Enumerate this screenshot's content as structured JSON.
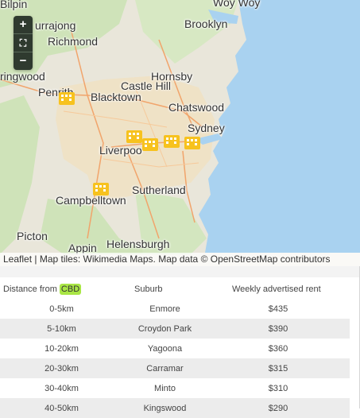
{
  "map": {
    "places": [
      {
        "key": "bilpin",
        "name": "Bilpin"
      },
      {
        "key": "kurrajong",
        "name": "urrajong"
      },
      {
        "key": "richmond",
        "name": "Richmond"
      },
      {
        "key": "springwood",
        "name": "ringwood"
      },
      {
        "key": "penrith",
        "name": "Penrith"
      },
      {
        "key": "blacktown",
        "name": "Blacktown"
      },
      {
        "key": "castlehill",
        "name": "Castle Hill"
      },
      {
        "key": "hornsby",
        "name": "Hornsby"
      },
      {
        "key": "brooklyn",
        "name": "Brooklyn"
      },
      {
        "key": "woywoy",
        "name": "Woy Woy"
      },
      {
        "key": "chatswood",
        "name": "Chatswood"
      },
      {
        "key": "sydney",
        "name": "Sydney"
      },
      {
        "key": "liverpool",
        "name": "Liverpoo"
      },
      {
        "key": "sutherland",
        "name": "Sutherland"
      },
      {
        "key": "campbelltown",
        "name": "Campbelltown"
      },
      {
        "key": "picton",
        "name": "Picton"
      },
      {
        "key": "appin",
        "name": "Appin"
      },
      {
        "key": "helensburgh",
        "name": "Helensburgh"
      }
    ],
    "zoom": {
      "in_label": "+",
      "fullscreen_label": "⛶",
      "out_label": "−"
    },
    "marker_icon": "building-marker-icon",
    "attribution": {
      "leaflet": "Leaflet",
      "separator": " | ",
      "text": "Map tiles: Wikimedia Maps. Map data © OpenStreetMap contributors"
    },
    "colors": {
      "sea": "#a9d2f0",
      "land": "#e9e6da",
      "green": "#cfe3b9",
      "marker": "#f7c21e"
    }
  },
  "table": {
    "headers": {
      "distance_prefix": "Distance from ",
      "distance_highlight": "CBD",
      "suburb": "Suburb",
      "rent": "Weekly advertised rent"
    },
    "rows": [
      {
        "distance": "0-5km",
        "suburb": "Enmore",
        "rent": "$435"
      },
      {
        "distance": "5-10km",
        "suburb": "Croydon Park",
        "rent": "$390"
      },
      {
        "distance": "10-20km",
        "suburb": "Yagoona",
        "rent": "$360"
      },
      {
        "distance": "20-30km",
        "suburb": "Carramar",
        "rent": "$315"
      },
      {
        "distance": "30-40km",
        "suburb": "Minto",
        "rent": "$310"
      },
      {
        "distance": "40-50km",
        "suburb": "Kingswood",
        "rent": "$290"
      }
    ],
    "colors": {
      "highlight": "#a9e645",
      "row_alt": "#ececec"
    }
  }
}
